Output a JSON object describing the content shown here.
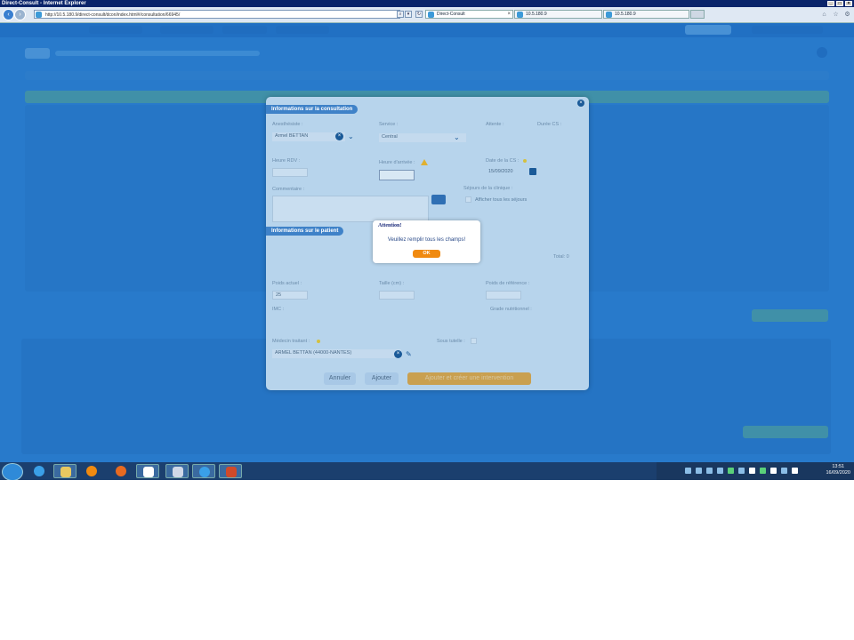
{
  "window": {
    "title": "Direct-Consult - Internet Explorer"
  },
  "browser": {
    "address": "http://10.5.180.9/direct-consult/dcon/index.html#/consultation/66945/",
    "tabs": [
      {
        "label": "Direct-Consult",
        "active": true
      },
      {
        "label": "10.5.180.9",
        "active": false
      },
      {
        "label": "10.5.180.9",
        "active": false
      }
    ]
  },
  "modal": {
    "consultation_section": "Informations sur la consultation",
    "anesthesiste_label": "Anesthésiste :",
    "anesthesiste_value": "Armel BETTAN",
    "service_label": "Service :",
    "service_value": "Central",
    "attente_label": "Attente :",
    "duree_label": "Durée CS :",
    "heure_rdv_label": "Heure RDV :",
    "heure_arrivee_label": "Heure d'arrivée :",
    "date_cs_label": "Date de la CS :",
    "date_cs_value": "15/09/2020",
    "commentaire_label": "Commentaire :",
    "sejours_label": "Séjours de la clinique :",
    "afficher_sejours_label": "Afficher tous les séjours",
    "patient_section": "Informations sur le patient",
    "total_label": "Total: 0",
    "poids_label": "Poids actuel :",
    "poids_value": "25",
    "taille_label": "Taille (cm) :",
    "poids_ref_label": "Poids de référence :",
    "imc_label": "IMC :",
    "grade_label": "Grade nutritionnel :",
    "medecin_label": "Médecin traitant :",
    "medecin_value": "ARMEL BETTAN (44000-NANTES)",
    "sous_tutelle_label": "Sous tutelle :",
    "btn_annuler": "Annuler",
    "btn_ajouter": "Ajouter",
    "btn_ajouter_creer": "Ajouter et créer une intervention"
  },
  "alert": {
    "title": "Attention!",
    "message": "Veuillez remplir tous les champs!",
    "ok": "OK"
  },
  "taskbar": {
    "time": "13:51",
    "date": "16/09/2020"
  },
  "colors": {
    "overlay_blue": "#2f82cf",
    "modal_bg": "#b7d4ec",
    "ok_orange": "#f08a10",
    "section_blue": "#3f82c8"
  }
}
